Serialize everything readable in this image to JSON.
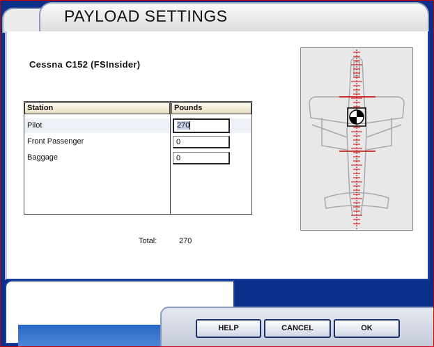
{
  "window": {
    "title": "PAYLOAD SETTINGS"
  },
  "aircraft": {
    "name": "Cessna C152 (FSInsider)"
  },
  "table": {
    "headers": {
      "station": "Station",
      "pounds": "Pounds"
    },
    "rows": [
      {
        "station": "Pilot",
        "pounds": "270"
      },
      {
        "station": "Front Passenger",
        "pounds": "0"
      },
      {
        "station": "Baggage",
        "pounds": "0"
      }
    ]
  },
  "total": {
    "label": "Total:",
    "value": "270"
  },
  "buttons": {
    "help": "HELP",
    "cancel": "CANCEL",
    "ok": "OK"
  },
  "colors": {
    "accent_blue": "#1b3f9b",
    "frame_red": "#c40000",
    "cg_marker": "#cc0000"
  }
}
